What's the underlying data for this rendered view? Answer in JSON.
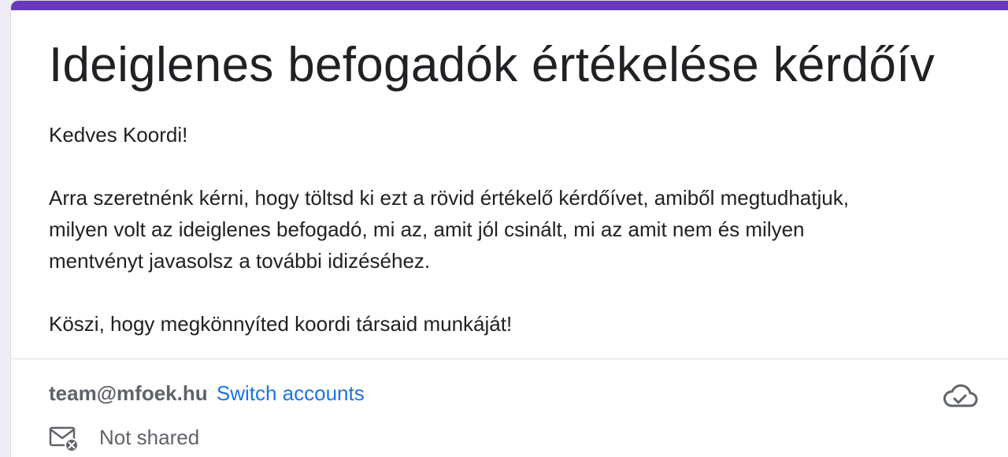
{
  "form": {
    "title": "Ideiglenes befogadók értékelése kérdőív",
    "greeting": "Kedves Koordi!",
    "body": "Arra szeretnénk kérni, hogy töltsd ki ezt a rövid értékelő kérdőívet, amiből megtudhatjuk,\nmilyen volt az ideiglenes befogadó, mi az, amit jól csinált, mi az amit nem és milyen\nmentvényt javasolsz a további idizéséhez.",
    "closing": "Köszi, hogy megkönnyíted koordi társaid munkáját!"
  },
  "account": {
    "email": "team@mfoek.hu",
    "switch_label": "Switch accounts",
    "sharing_status": "Not shared",
    "save_icon": "cloud-saved-icon",
    "sharing_icon": "mail-not-shared-icon"
  },
  "colors": {
    "accent": "#673ab7",
    "link": "#1a73e8",
    "background": "#f0ebf8"
  }
}
